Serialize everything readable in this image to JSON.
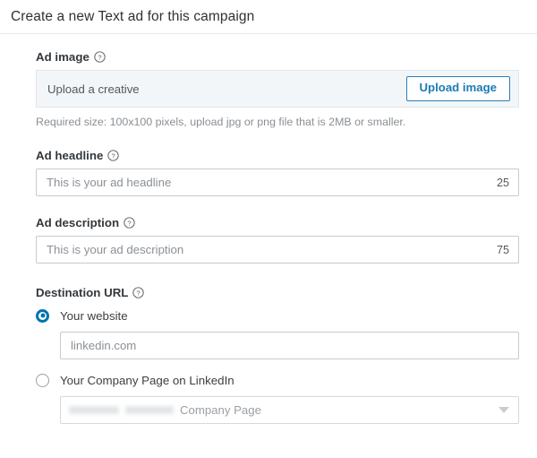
{
  "header": {
    "title": "Create a new Text ad for this campaign"
  },
  "sections": {
    "ad_image": {
      "label": "Ad image",
      "help_icon": "help-circle-icon",
      "upload_text": "Upload a creative",
      "upload_button_label": "Upload image",
      "helper_text": "Required size: 100x100 pixels, upload jpg or png file that is 2MB or smaller."
    },
    "ad_headline": {
      "label": "Ad headline",
      "help_icon": "help-circle-icon",
      "placeholder": "This is your ad headline",
      "char_counter": "25"
    },
    "ad_description": {
      "label": "Ad description",
      "help_icon": "help-circle-icon",
      "placeholder": "This is your ad description",
      "char_counter": "75"
    },
    "destination_url": {
      "label": "Destination URL",
      "help_icon": "help-circle-icon",
      "option_website": {
        "label": "Your website",
        "selected": true,
        "input_value": "linkedin.com"
      },
      "option_company_page": {
        "label": "Your Company Page on LinkedIn",
        "selected": false,
        "select_redacted": true,
        "select_value": "Company Page",
        "caret_icon": "chevron-down-icon"
      }
    }
  },
  "colors": {
    "accent_blue": "#0073b1",
    "button_border_blue": "#2a7fb8",
    "panel_gray": "#f3f6f8",
    "text_primary": "#33383c",
    "text_muted": "#8a8f94"
  }
}
